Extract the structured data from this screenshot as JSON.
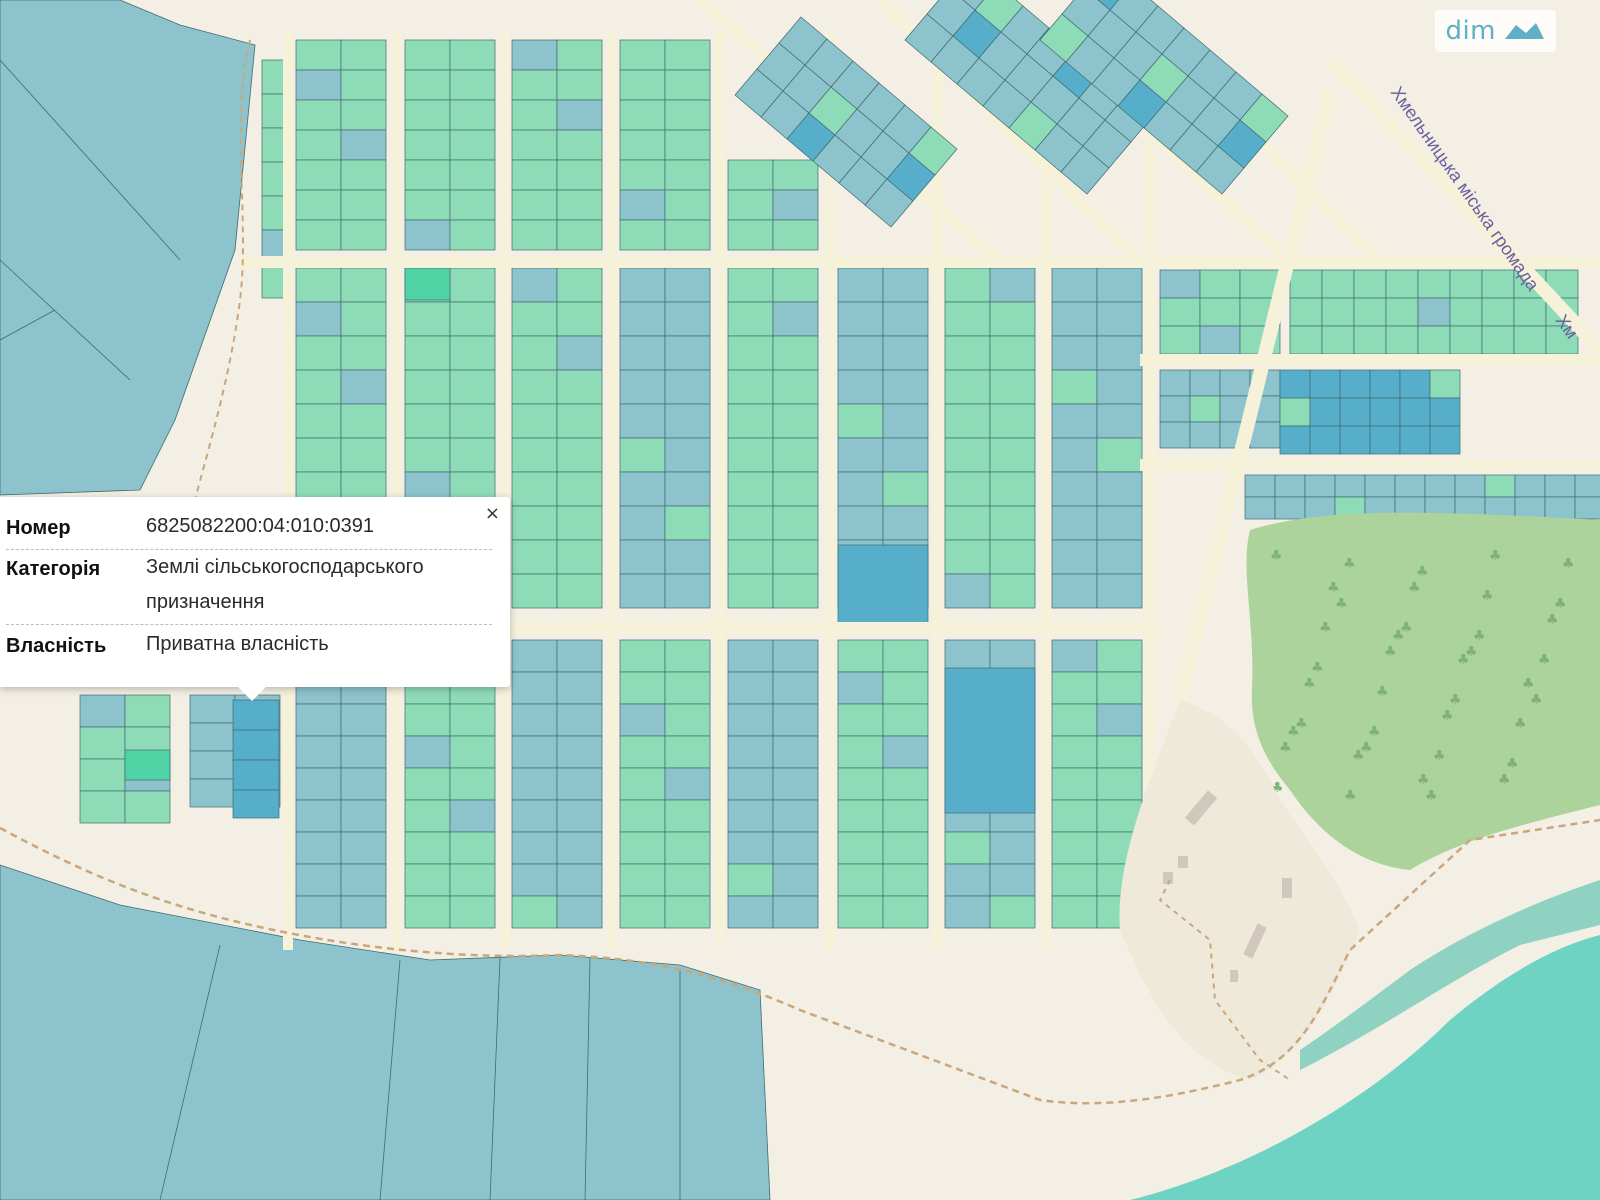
{
  "watermark": {
    "text": "dim",
    "mark": "ria",
    "color": "#5fb0c6"
  },
  "map": {
    "colors": {
      "background": "#f3efe4",
      "road": "#f6f2d9",
      "parcel_green": "#8edbb8",
      "parcel_blue": "#8dc3cd",
      "parcel_dark": "#57aecb",
      "parcel_teal": "#4fd3a5",
      "parcel_outline": "#3f6b6e",
      "forest": "#acd39b",
      "water": "#6fd3c4",
      "boundary": "#c9a77b"
    },
    "road_label": "Хмельницька міська громада",
    "road_label_short": "Хм"
  },
  "popup": {
    "close_label": "×",
    "rows": [
      {
        "key": "Номер",
        "value": "6825082200:04:010:0391"
      },
      {
        "key": "Категорія",
        "value": "Землі сільськогосподарського призначення"
      },
      {
        "key": "Власність",
        "value": "Приватна власність"
      }
    ]
  }
}
